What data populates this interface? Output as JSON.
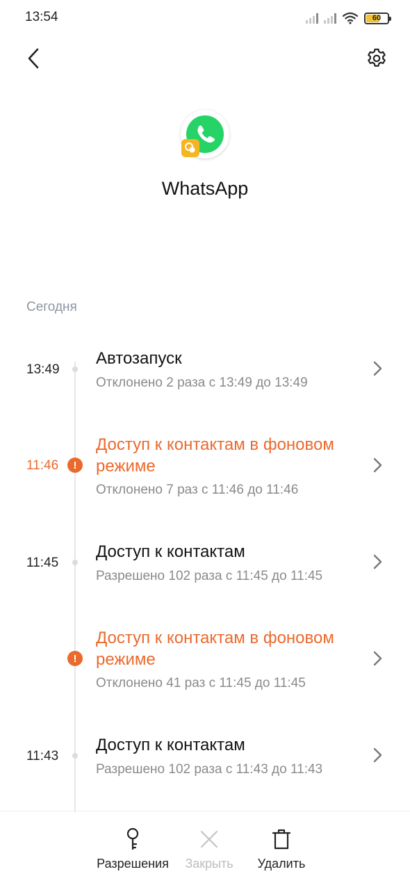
{
  "status_bar": {
    "time": "13:54",
    "battery_level": "60"
  },
  "app": {
    "name": "WhatsApp"
  },
  "section": {
    "label": "Сегодня"
  },
  "events": [
    {
      "time": "13:49",
      "title": "Автозапуск",
      "subtitle": "Отклонено 2 раза с 13:49 до 13:49",
      "warning": false
    },
    {
      "time": "11:46",
      "title": "Доступ к контактам в фоновом режиме",
      "subtitle": "Отклонено 7 раз с 11:46 до 11:46",
      "warning": true
    },
    {
      "time": "11:45",
      "title": "Доступ к контактам",
      "subtitle": "Разрешено 102 раза с 11:45 до 11:45",
      "warning": false
    },
    {
      "time": "",
      "title": "Доступ к контактам в фоновом режиме",
      "subtitle": "Отклонено 41 раз с 11:45 до 11:45",
      "warning": true
    },
    {
      "time": "11:43",
      "title": "Доступ к контактам",
      "subtitle": "Разрешено 102 раза с 11:43 до 11:43",
      "warning": false
    }
  ],
  "bottom_bar": {
    "permissions_label": "Разрешения",
    "close_label": "Закрыть",
    "delete_label": "Удалить"
  },
  "colors": {
    "warning": "#ea6a2e",
    "whatsapp_green": "#25d366",
    "badge_yellow": "#f5b522"
  },
  "icons": [
    "back-arrow-icon",
    "gear-icon",
    "whatsapp-icon",
    "dual-app-badge-icon",
    "chevron-right-icon",
    "alert-icon",
    "key-icon",
    "close-icon",
    "trash-icon"
  ]
}
